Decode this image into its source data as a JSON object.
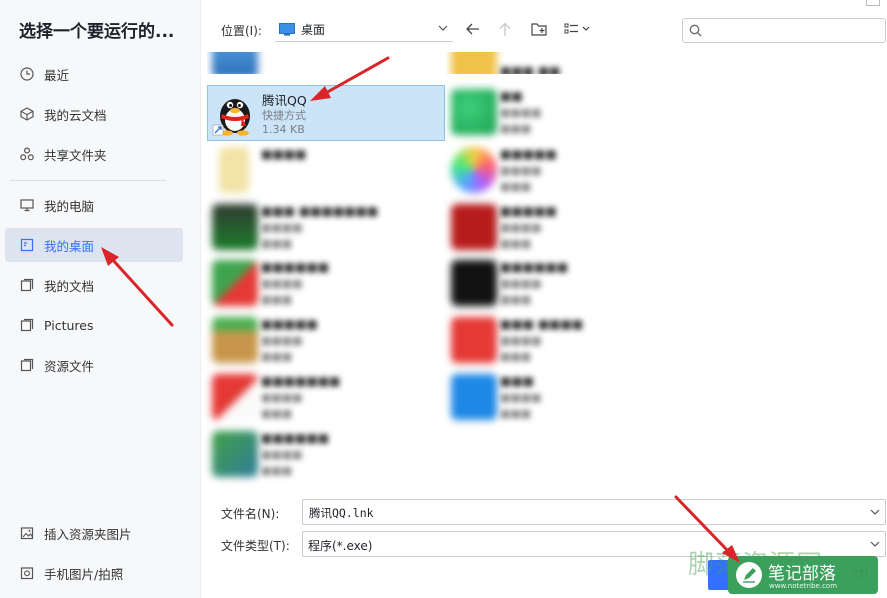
{
  "dialog": {
    "title": "选择一个要运行的..."
  },
  "sidebar": {
    "items": [
      {
        "label": "最近",
        "icon": "clock-icon"
      },
      {
        "label": "我的云文档",
        "icon": "cloud-doc-icon"
      },
      {
        "label": "共享文件夹",
        "icon": "share-icon"
      },
      {
        "label": "我的电脑",
        "icon": "monitor-icon"
      },
      {
        "label": "我的桌面",
        "icon": "desktop-icon",
        "active": true
      },
      {
        "label": "我的文档",
        "icon": "documents-icon"
      },
      {
        "label": "Pictures",
        "icon": "folder-icon"
      },
      {
        "label": "资源文件",
        "icon": "folder-icon"
      }
    ],
    "bottom": [
      {
        "label": "插入资源夹图片",
        "icon": "image-insert-icon"
      },
      {
        "label": "手机图片/拍照",
        "icon": "phone-photo-icon"
      }
    ]
  },
  "toolbar": {
    "location_label": "位置(I):",
    "location_value": "桌面",
    "search_placeholder": ""
  },
  "files": {
    "selected": {
      "name": "腾讯QQ",
      "type": "快捷方式",
      "size": "1.34 KB"
    }
  },
  "form": {
    "filename_label": "文件名(N):",
    "filename_value": "腾讯QQ.lnk",
    "filetype_label": "文件类型(T):",
    "filetype_value": "程序(*.exe)"
  },
  "watermark": {
    "big": "脚茫资源网",
    "badge": "笔记部落",
    "url": "www.notetribe.com",
    "suffix": "cn"
  },
  "colors": {
    "accent": "#3370ff",
    "selection_bg": "#cce4f7",
    "arrow": "#d9252a"
  }
}
